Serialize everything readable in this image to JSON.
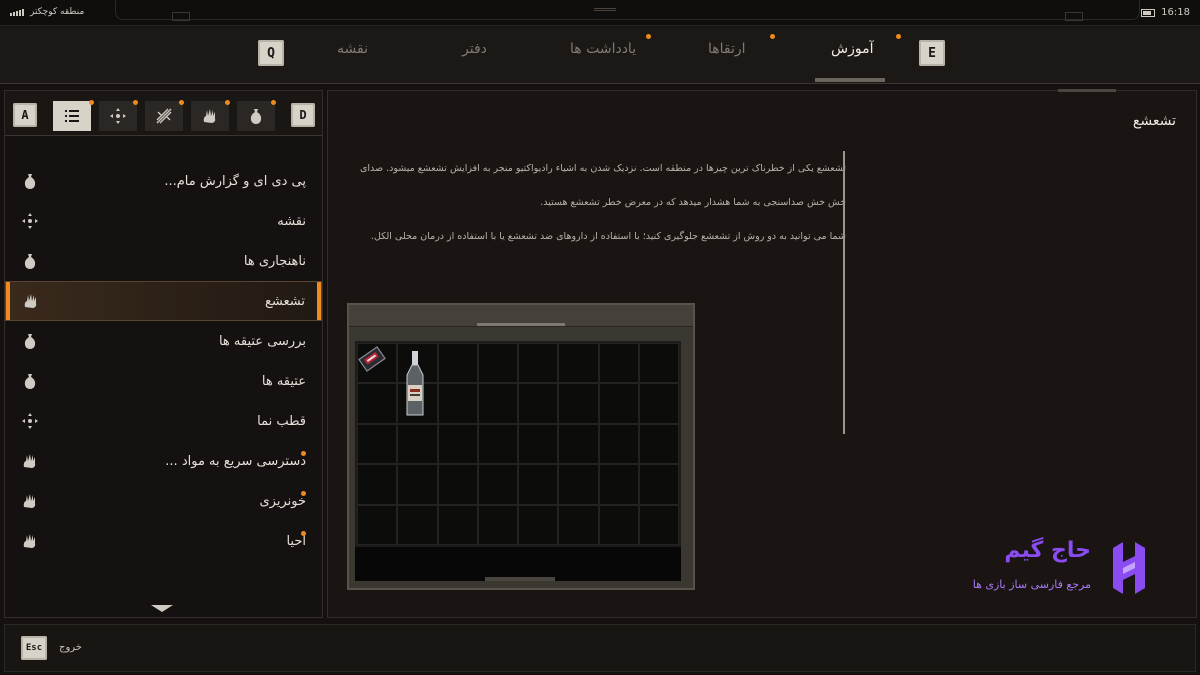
{
  "status": {
    "region": "منطقه کوچکتر",
    "clock": "16:18"
  },
  "tabs": {
    "q_key": "Q",
    "e_key": "E",
    "items": [
      {
        "label": "نقشه"
      },
      {
        "label": "دفتر"
      },
      {
        "label": "یادداشت ها"
      },
      {
        "label": "ارتقاها"
      },
      {
        "label": "آموزش"
      }
    ]
  },
  "sidebar": {
    "key_a": "A",
    "key_d": "D",
    "tools": [
      "list-icon",
      "crosshair-icon",
      "sword-cross-icon",
      "hand-icon",
      "sack-icon"
    ],
    "items": [
      {
        "label": "پی دی ای و گزارش مام...",
        "icon": "sack"
      },
      {
        "label": "نقشه",
        "icon": "compass"
      },
      {
        "label": "ناهنجاری ها",
        "icon": "sack"
      },
      {
        "label": "تشعشع",
        "icon": "hand"
      },
      {
        "label": "بررسی عتیقه ها",
        "icon": "sack"
      },
      {
        "label": "عتیقه ها",
        "icon": "sack"
      },
      {
        "label": "قطب نما",
        "icon": "compass"
      },
      {
        "label": "دسترسی سریع به مواد ...",
        "icon": "hand"
      },
      {
        "label": "خونریزی",
        "icon": "hand"
      },
      {
        "label": "احیا",
        "icon": "hand"
      }
    ]
  },
  "content": {
    "title": "تشعشع",
    "paragraphs": [
      "تشعشع یکی از خطرناک ترین چیزها در منطقه است. نزدیک شدن به اشیاء رادیواکتیو منجر به افزایش تشعشع میشود. صدای",
      "خش خش صداسنجی به شما هشدار میدهد که در معرض خطر تشعشع هستید.",
      "شما می توانید به دو روش از تشعشع جلوگیری کنید؛ با استفاده از داروهای ضد تشعشع یا با استفاده از درمان محلی الکل."
    ]
  },
  "footer": {
    "esc_key": "Esc",
    "exit_label": "خروج"
  },
  "watermark": {
    "name": "حاج گیم",
    "tagline": "مرجع فارسی ساز بازی ها"
  },
  "colors": {
    "accent": "#f08a1e",
    "watermark": "#8a4cf0"
  }
}
